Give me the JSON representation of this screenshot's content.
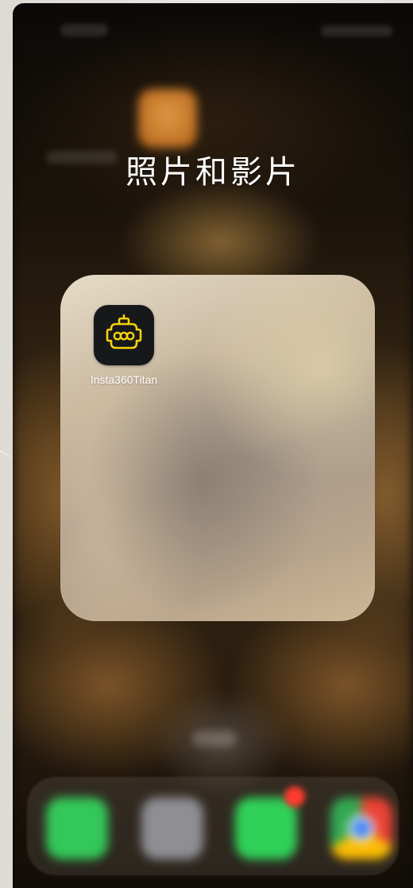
{
  "folder": {
    "title": "照片和影片",
    "apps": [
      {
        "label": "Insta360Titan",
        "icon": "insta360-titan-camera-icon",
        "icon_color": "#f5d20a",
        "bg_color": "#17181a"
      }
    ]
  },
  "dock": {
    "apps": [
      "phone-app-icon",
      "files-app-icon",
      "messages-app-icon",
      "chrome-app-icon"
    ]
  },
  "colors": {
    "accent_yellow": "#f5d20a",
    "folder_panel": "#b8a48c"
  }
}
